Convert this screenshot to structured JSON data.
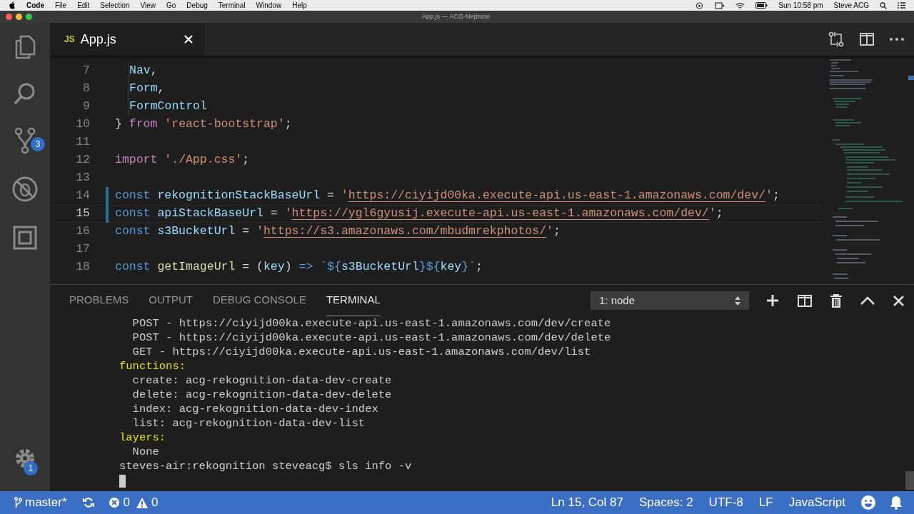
{
  "menu_bar": {
    "app": "Code",
    "items": [
      "File",
      "Edit",
      "Selection",
      "View",
      "Go",
      "Debug",
      "Terminal",
      "Window",
      "Help"
    ],
    "clock": "Sun 10:58 pm",
    "user": "Steve ACG"
  },
  "window": {
    "title": "App.js — ACG-Neptune"
  },
  "activity_bar": {
    "scm_badge": "3",
    "settings_badge": "1"
  },
  "tabs": [
    {
      "icon_text": "JS",
      "label": "App.js",
      "selected": true
    }
  ],
  "editor": {
    "lines": [
      {
        "number": "7",
        "current": false,
        "changed": false,
        "indented": true,
        "tokens": [
          {
            "kind": "var",
            "text": "Nav"
          },
          {
            "kind": "plain",
            "text": ","
          }
        ]
      },
      {
        "number": "8",
        "current": false,
        "changed": false,
        "indented": true,
        "tokens": [
          {
            "kind": "var",
            "text": "Form"
          },
          {
            "kind": "plain",
            "text": ","
          }
        ]
      },
      {
        "number": "9",
        "current": false,
        "changed": false,
        "indented": true,
        "tokens": [
          {
            "kind": "var",
            "text": "FormControl"
          }
        ]
      },
      {
        "number": "10",
        "current": false,
        "changed": false,
        "indented": false,
        "tokens": [
          {
            "kind": "plain",
            "text": "}"
          },
          {
            "kind": "control",
            "text": " from"
          },
          {
            "kind": "string",
            "text": " 'react-bootstrap'"
          },
          {
            "kind": "plain",
            "text": ";"
          }
        ]
      },
      {
        "number": "11",
        "current": false,
        "changed": false
      },
      {
        "number": "12",
        "current": false,
        "changed": false,
        "indented": false,
        "tokens": [
          {
            "kind": "control",
            "text": "import"
          },
          {
            "kind": "string",
            "text": " './App.css'"
          },
          {
            "kind": "plain",
            "text": ";"
          }
        ]
      },
      {
        "number": "13",
        "current": false,
        "changed": false
      },
      {
        "number": "14",
        "current": false,
        "changed": true,
        "indented": false,
        "tokens": [
          {
            "kind": "keyword",
            "text": "const"
          },
          {
            "kind": "var",
            "text": " rekognitionStackBaseUrl"
          },
          {
            "kind": "plain",
            "text": " ="
          },
          {
            "kind": "string",
            "text": " '"
          },
          {
            "kind": "url",
            "text": "https://ciyijd00ka.execute-api.us-east-1.amazonaws.com/dev/"
          },
          {
            "kind": "string",
            "text": "'"
          },
          {
            "kind": "plain",
            "text": ";"
          }
        ]
      },
      {
        "number": "15",
        "current": true,
        "changed": true,
        "indented": false,
        "tokens": [
          {
            "kind": "keyword",
            "text": "const"
          },
          {
            "kind": "var",
            "text": " apiStackBaseUrl"
          },
          {
            "kind": "plain",
            "text": " ="
          },
          {
            "kind": "string",
            "text": " '"
          },
          {
            "kind": "url",
            "text": "https://ygl6gyusij.execute-api.us-east-1.amazonaws.com/dev/"
          },
          {
            "kind": "string",
            "text": "'"
          },
          {
            "kind": "plain",
            "text": ";"
          }
        ]
      },
      {
        "number": "16",
        "current": false,
        "changed": false,
        "indented": false,
        "tokens": [
          {
            "kind": "keyword",
            "text": "const"
          },
          {
            "kind": "var",
            "text": " s3BucketUrl"
          },
          {
            "kind": "plain",
            "text": " ="
          },
          {
            "kind": "string",
            "text": " '"
          },
          {
            "kind": "url",
            "text": "https://s3.amazonaws.com/mbudmrekphotos/"
          },
          {
            "kind": "string",
            "text": "'"
          },
          {
            "kind": "plain",
            "text": ";"
          }
        ]
      },
      {
        "number": "17",
        "current": false,
        "changed": false
      },
      {
        "number": "18",
        "current": false,
        "changed": false,
        "indented": false,
        "tokens": [
          {
            "kind": "keyword",
            "text": "const"
          },
          {
            "kind": "func",
            "text": " getImageUrl"
          },
          {
            "kind": "plain",
            "text": " = ("
          },
          {
            "kind": "var",
            "text": "key"
          },
          {
            "kind": "plain",
            "text": ")"
          },
          {
            "kind": "keyword",
            "text": " =>"
          },
          {
            "kind": "string",
            "text": " `"
          },
          {
            "kind": "keyword",
            "text": "${"
          },
          {
            "kind": "var",
            "text": "s3BucketUrl"
          },
          {
            "kind": "keyword",
            "text": "}${"
          },
          {
            "kind": "var",
            "text": "key"
          },
          {
            "kind": "keyword",
            "text": "}"
          },
          {
            "kind": "string",
            "text": "`"
          },
          {
            "kind": "plain",
            "text": ";"
          }
        ]
      }
    ]
  },
  "panel": {
    "tabs": [
      {
        "label": "PROBLEMS",
        "selected": false
      },
      {
        "label": "OUTPUT",
        "selected": false
      },
      {
        "label": "DEBUG CONSOLE",
        "selected": false
      },
      {
        "label": "TERMINAL",
        "selected": true
      }
    ],
    "terminal_select": "1: node",
    "terminal_lines": [
      {
        "kind": "plain",
        "text": "  POST - https://ciyijd00ka.execute-api.us-east-1.amazonaws.com/dev/create"
      },
      {
        "kind": "plain",
        "text": "  POST - https://ciyijd00ka.execute-api.us-east-1.amazonaws.com/dev/delete"
      },
      {
        "kind": "plain",
        "text": "  GET - https://ciyijd00ka.execute-api.us-east-1.amazonaws.com/dev/list"
      },
      {
        "kind": "heading",
        "text": "functions:"
      },
      {
        "kind": "plain",
        "text": "  create: acg-rekognition-data-dev-create"
      },
      {
        "kind": "plain",
        "text": "  delete: acg-rekognition-data-dev-delete"
      },
      {
        "kind": "plain",
        "text": "  index: acg-rekognition-data-dev-index"
      },
      {
        "kind": "plain",
        "text": "  list: acg-rekognition-data-dev-list"
      },
      {
        "kind": "heading",
        "text": "layers:"
      },
      {
        "kind": "plain",
        "text": "  None"
      },
      {
        "kind": "plain",
        "text": "steves-air:rekognition steveacg$ sls info -v"
      },
      {
        "kind": "cursor"
      }
    ]
  },
  "status_bar": {
    "branch": "master*",
    "errors": "0",
    "warnings": "0",
    "position": "Ln 15, Col 87",
    "indent": "Spaces: 2",
    "encoding": "UTF-8",
    "eol": "LF",
    "language": "JavaScript"
  }
}
